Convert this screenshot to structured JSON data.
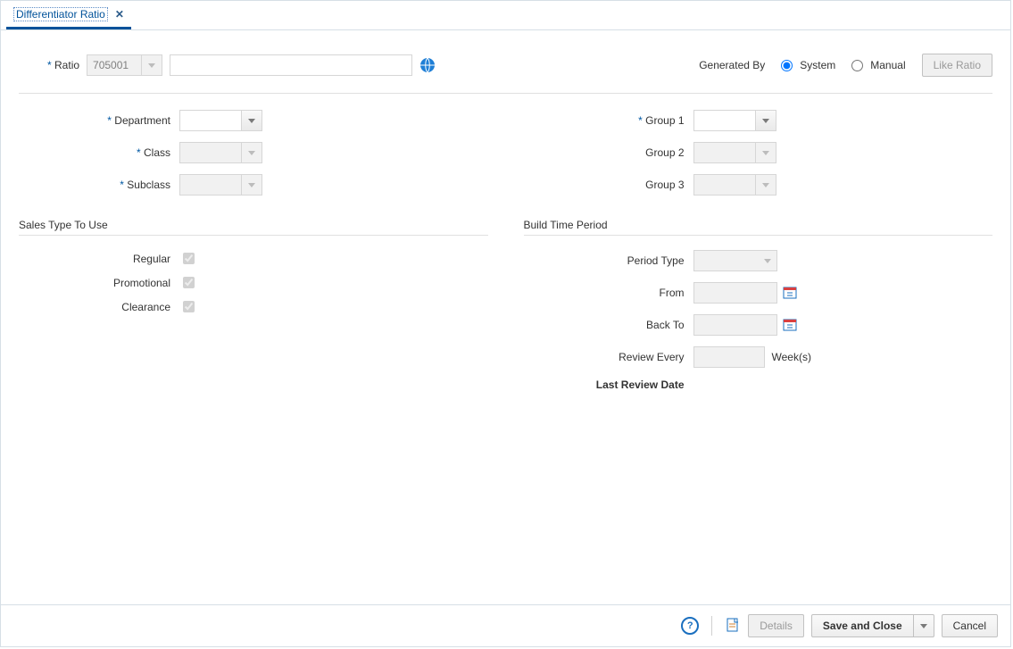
{
  "tab": {
    "title": "Differentiator Ratio"
  },
  "top": {
    "ratio_label": "Ratio",
    "ratio_value": "705001",
    "globe_name": "translate-icon",
    "generated_by_label": "Generated By",
    "system_label": "System",
    "manual_label": "Manual",
    "like_ratio_label": "Like Ratio"
  },
  "left_fields": {
    "department": "Department",
    "class": "Class",
    "subclass": "Subclass"
  },
  "right_fields": {
    "group1": "Group 1",
    "group2": "Group 2",
    "group3": "Group 3"
  },
  "sales_type": {
    "title": "Sales Type To Use",
    "regular": "Regular",
    "promotional": "Promotional",
    "clearance": "Clearance"
  },
  "build_time": {
    "title": "Build Time Period",
    "period_type": "Period Type",
    "from": "From",
    "back_to": "Back To",
    "review_every": "Review Every",
    "weeks": "Week(s)",
    "last_review_date": "Last Review Date"
  },
  "footer": {
    "details": "Details",
    "save_and_close": "Save and Close",
    "cancel": "Cancel"
  }
}
